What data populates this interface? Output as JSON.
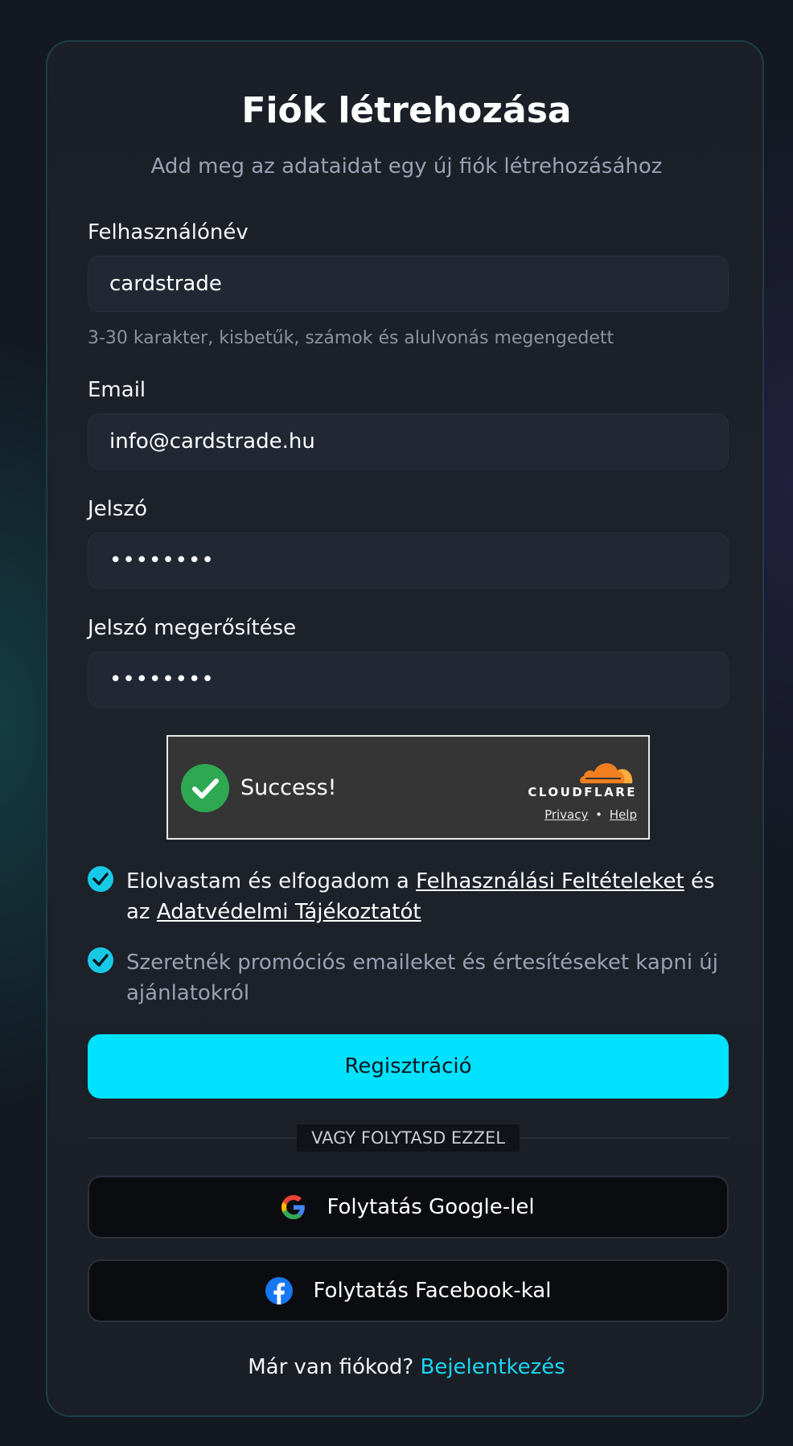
{
  "form": {
    "title": "Fiók létrehozása",
    "subtitle": "Add meg az adataidat egy új fiók létrehozásához",
    "username": {
      "label": "Felhasználónév",
      "value": "cardstrade",
      "hint": "3-30 karakter, kisbetűk, számok és alulvonás megengedett"
    },
    "email": {
      "label": "Email",
      "value": "info@cardstrade.hu"
    },
    "password": {
      "label": "Jelszó",
      "value": "••••••••"
    },
    "password_confirm": {
      "label": "Jelszó megerősítése",
      "value": "••••••••"
    }
  },
  "captcha": {
    "status": "Success!",
    "brand": "CLOUDFLARE",
    "privacy_link": "Privacy",
    "separator": "•",
    "help_link": "Help",
    "colors": {
      "check": "#2ea851",
      "cloud": "#f38020"
    }
  },
  "consents": {
    "terms": {
      "checked": true,
      "text_before": "Elolvastam és elfogadom a ",
      "terms_link": "Felhasználási Feltételeket",
      "text_middle": " és az ",
      "privacy_link": "Adatvédelmi Tájékoztatót"
    },
    "marketing": {
      "checked": true,
      "text": "Szeretnék promóciós emaileket és értesítéseket kapni új ajánlatokról"
    }
  },
  "actions": {
    "register_label": "Regisztráció",
    "divider_label": "VAGY FOLYTASD EZZEL",
    "google_label": "Folytatás Google-lel",
    "facebook_label": "Folytatás Facebook-kal"
  },
  "footer": {
    "question": "Már van fiókod? ",
    "login_link": "Bejelentkezés"
  },
  "theme": {
    "accent": "#00e2ff",
    "background": "#131821",
    "card": "#1b1f27"
  }
}
